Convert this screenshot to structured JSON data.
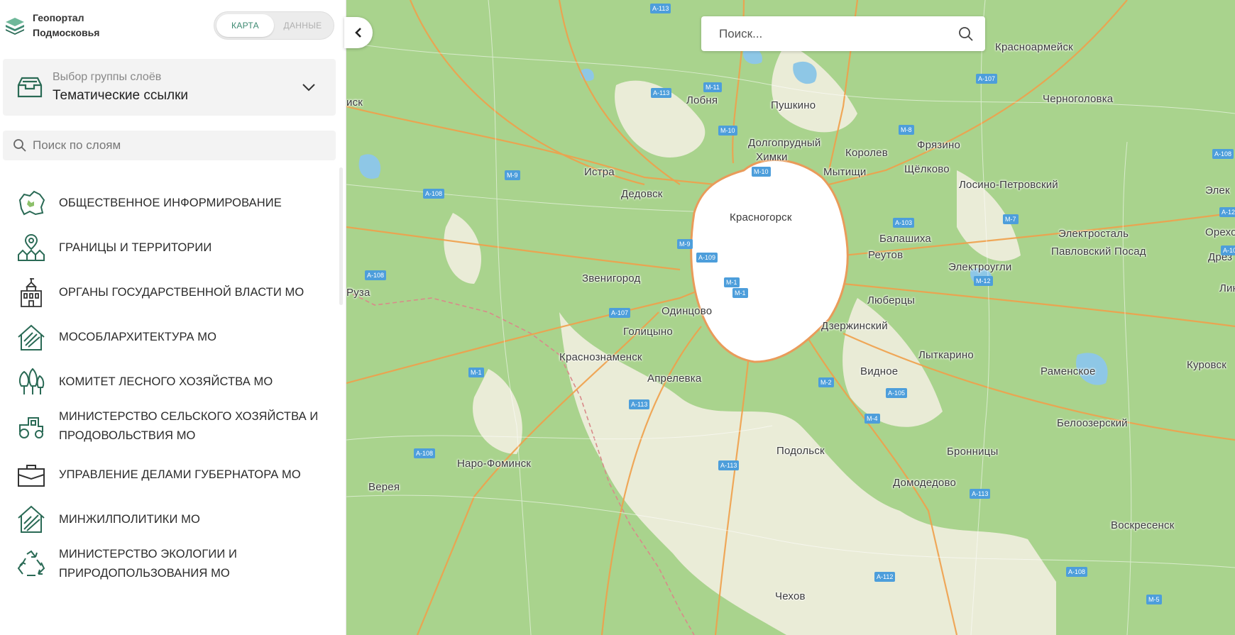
{
  "app": {
    "title_line1": "Геопортал",
    "title_line2": "Подмосковья",
    "toggle_map": "КАРТА",
    "toggle_data": "ДАННЫЕ"
  },
  "layer_group": {
    "caption": "Выбор группы слоёв",
    "value": "Тематические ссылки"
  },
  "layer_search": {
    "placeholder": "Поиск по слоям"
  },
  "map_search": {
    "placeholder": "Поиск..."
  },
  "categories": [
    {
      "label": "ОБЩЕСТВЕННОЕ ИНФОРМИРОВАНИЕ",
      "icon": "region-map-icon"
    },
    {
      "label": "ГРАНИЦЫ И ТЕРРИТОРИИ",
      "icon": "location-pin-houses-icon"
    },
    {
      "label": "ОРГАНЫ ГОСУДАРСТВЕННОЙ ВЛАСТИ МО",
      "icon": "government-building-icon"
    },
    {
      "label": "МОСОБЛАРХИТЕКТУРА МО",
      "icon": "architecture-house-icon"
    },
    {
      "label": "КОМИТЕТ ЛЕСНОГО ХОЗЯЙСТВА МО",
      "icon": "forest-trees-icon"
    },
    {
      "label_line1": "МИНИСТЕРСТВО СЕЛЬСКОГО ХОЗЯЙСТВА И",
      "label_line2": "ПРОДОВОЛЬСТВИЯ МО",
      "icon": "tractor-icon"
    },
    {
      "label": "УПРАВЛЕНИЕ ДЕЛАМИ ГУБЕРНАТОРА МО",
      "icon": "briefcase-icon"
    },
    {
      "label": "МИНЖИЛПОЛИТИКИ МО",
      "icon": "housing-plan-icon"
    },
    {
      "label_line1": "МИНИСТЕРСТВО ЭКОЛОГИИ И",
      "label_line2": "ПРИРОДОПОЛЬЗОВАНИЯ МО",
      "icon": "recycle-icon"
    }
  ],
  "map": {
    "cities": [
      "Лобня",
      "Пушкино",
      "Красноармейск",
      "Черноголовка",
      "Долгопрудный",
      "Химки",
      "Королев",
      "Фрязино",
      "Мытищи",
      "Щёлково",
      "Истра",
      "Лосино-Петровский",
      "Дедовск",
      "Красногорск",
      "Электросталь",
      "Орехово",
      "Балашиха",
      "Реутов",
      "Павловский Посад",
      "Звенигород",
      "Электроугли",
      "Одинцово",
      "Люберцы",
      "Голицыно",
      "Дзержинский",
      "Краснознаменск",
      "Лыткарино",
      "Раменское",
      "Куровск",
      "Апрелевка",
      "Видное",
      "Белоозерский",
      "Наро-Фоминск",
      "Подольск",
      "Бронницы",
      "Верея",
      "Домодедово",
      "Воскресенск",
      "Чехов",
      "Руза",
      "Элек",
      "Дрез",
      "Лик",
      "иск"
    ],
    "roads": [
      "А-113",
      "М-11",
      "М-10",
      "М-8",
      "А-107",
      "А-113",
      "М-10",
      "М-9",
      "А-108",
      "А-103",
      "М-7",
      "А-12",
      "М-9",
      "А-109",
      "М-1",
      "М-1",
      "А-108",
      "А-107",
      "М-12",
      "М-1",
      "М-2",
      "А-105",
      "А-113",
      "М-4",
      "А-108",
      "А-113",
      "А-113",
      "А-108",
      "А-112",
      "М-5",
      "А-108",
      "А-108"
    ]
  },
  "colors": {
    "accent": "#3e8a72",
    "map_green": "#a9d38d",
    "map_light": "#f4f1e8",
    "road_orange": "#f0a04b",
    "road_shield": "#4d9edb"
  }
}
